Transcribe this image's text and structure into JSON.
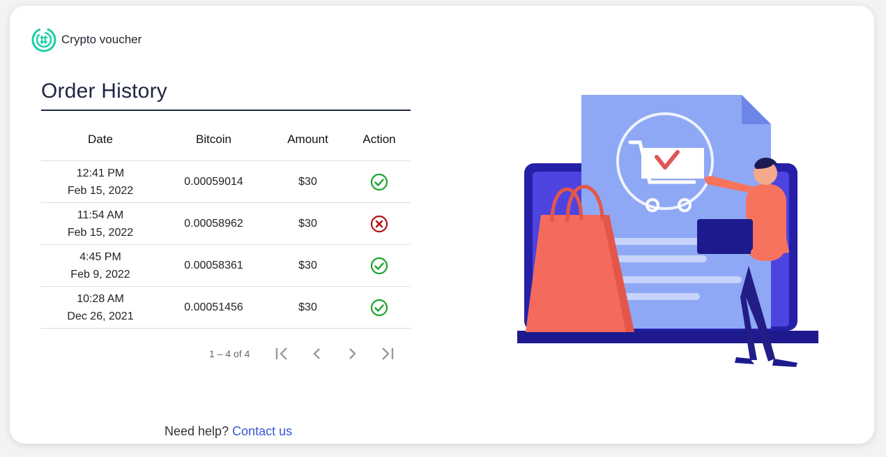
{
  "app": {
    "brand": "Crypto voucher",
    "accent_color": "#1ad0a8"
  },
  "page": {
    "title": "Order History"
  },
  "table": {
    "columns": [
      "Date",
      "Bitcoin",
      "Amount",
      "Action"
    ],
    "rows": [
      {
        "time": "12:41 PM",
        "date": "Feb 15, 2022",
        "bitcoin": "0.00059014",
        "amount": "$30",
        "status": "success",
        "icon": "check-circle-icon"
      },
      {
        "time": "11:54 AM",
        "date": "Feb 15, 2022",
        "bitcoin": "0.00058962",
        "amount": "$30",
        "status": "failed",
        "icon": "x-circle-icon"
      },
      {
        "time": "4:45 PM",
        "date": "Feb 9, 2022",
        "bitcoin": "0.00058361",
        "amount": "$30",
        "status": "success",
        "icon": "check-circle-icon"
      },
      {
        "time": "10:28 AM",
        "date": "Dec 26, 2021",
        "bitcoin": "0.00051456",
        "amount": "$30",
        "status": "success",
        "icon": "check-circle-icon"
      }
    ],
    "status_colors": {
      "success": "#1aa32a",
      "failed": "#b01010"
    }
  },
  "pagination": {
    "range": "1 – 4 of 4",
    "icons": [
      "first-page-icon",
      "previous-page-icon",
      "next-page-icon",
      "last-page-icon"
    ]
  },
  "footer": {
    "help_text": "Need help?",
    "contact_label": "Contact us"
  }
}
